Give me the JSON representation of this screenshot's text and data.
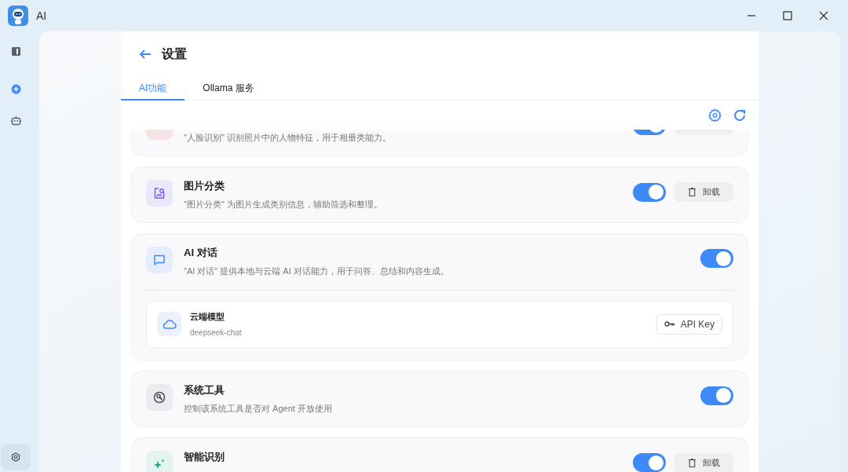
{
  "window": {
    "title": "AI"
  },
  "sidebar": {
    "items": [
      {
        "selected": false
      },
      {
        "selected": false
      },
      {
        "selected": false
      }
    ],
    "bottom": {
      "selected": true
    }
  },
  "page": {
    "title": "设置"
  },
  "tabs": [
    {
      "label": "AI功能",
      "selected": true
    },
    {
      "label": "Ollama 服务",
      "selected": false
    }
  ],
  "features": [
    {
      "description": "\"人脸识别\" 识别照片中的人物特征，用于相册类能力。",
      "color": "#f7e3e3",
      "actions": [
        {
          "kind": "toggle",
          "on": true
        },
        {
          "kind": "uninstall"
        }
      ]
    },
    {
      "title": "图片分类",
      "description": "\"图片分类\" 为图片生成类别信息，辅助筛选和整理。",
      "color": "#ece8fc",
      "actions": [
        {
          "kind": "toggle",
          "on": true
        },
        {
          "kind": "uninstall",
          "label": "卸载"
        }
      ]
    },
    {
      "title": "AI 对话",
      "description": "\"AI 对话\" 提供本地与云端 AI 对话能力，用于问答、总结和内容生成。",
      "color": "#e6eefc",
      "actions": [
        {
          "kind": "toggle",
          "on": true
        }
      ],
      "model": {
        "title": "云端模型",
        "name": "deepseek-chat",
        "button": "API Key"
      }
    },
    {
      "title": "系统工具",
      "description": "控制该系统工具是否对 Agent 开放使用",
      "color": "#ebecef",
      "actions": [
        {
          "kind": "toggle",
          "on": true
        }
      ]
    },
    {
      "title": "智能识别",
      "color": "#e3f3ef",
      "actions": [
        {
          "kind": "toggle",
          "on": true
        },
        {
          "kind": "uninstall",
          "label": "卸载"
        }
      ]
    }
  ]
}
